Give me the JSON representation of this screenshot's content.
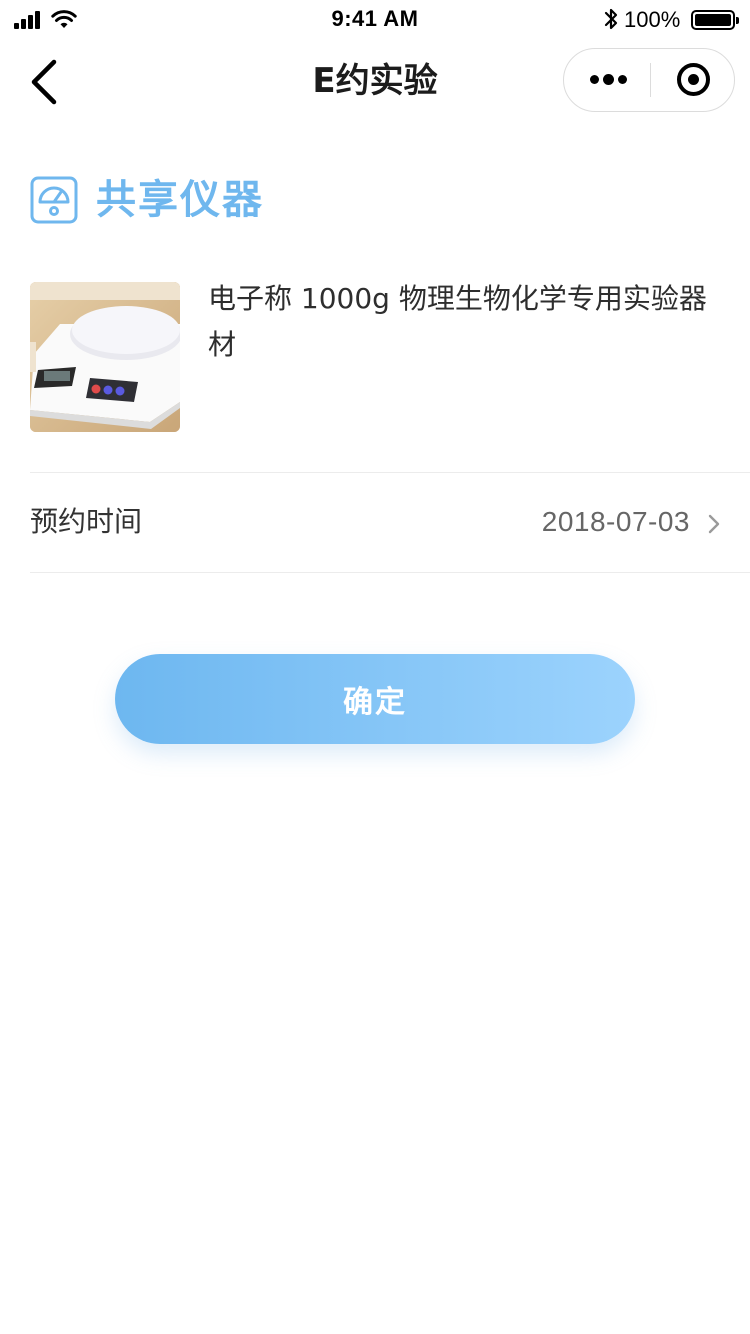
{
  "status_bar": {
    "time": "9:41 AM",
    "battery_percent": "100%",
    "signal_icon": "signal-bars-icon",
    "wifi_icon": "wifi-icon",
    "bluetooth_icon": "bluetooth-icon",
    "battery_icon": "battery-icon"
  },
  "nav": {
    "title": "E约实验",
    "back_icon": "chevron-left-icon",
    "more_icon": "more-dots-icon",
    "close_icon": "target-circle-icon"
  },
  "section": {
    "title": "共享仪器",
    "icon": "gauge-meter-icon",
    "accent_color": "#6fb7ee"
  },
  "product": {
    "image_icon": "electronic-scale-image",
    "name": "电子称 1000g 物理生物化学专用实验器材"
  },
  "booking": {
    "label": "预约时间",
    "value": "2018-07-03",
    "chevron_icon": "chevron-right-icon"
  },
  "actions": {
    "confirm_label": "确定",
    "gradient": [
      "#6db7f0",
      "#9cd3fd"
    ]
  }
}
